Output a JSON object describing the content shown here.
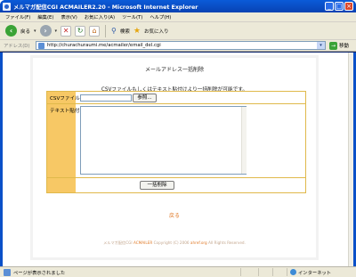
{
  "window": {
    "title": "メルマガ配信CGI ACMAILER2.20 - Microsoft Internet Explorer",
    "buttons": [
      "_",
      "□",
      "×"
    ]
  },
  "menubar": {
    "items": [
      "ファイル(F)",
      "編集(E)",
      "表示(V)",
      "お気に入り(A)",
      "ツール(T)",
      "ヘルプ(H)"
    ]
  },
  "toolbar": {
    "back_label": "戻る",
    "search_label": "検索",
    "favorites_label": "お気に入り"
  },
  "addressbar": {
    "label": "アドレス(D)",
    "url": "http://churachuraumi.me/acmailer/email_del.cgi",
    "go_label": "移動"
  },
  "page": {
    "heading": "メールアドレス一括削除",
    "note": "CSVファイルもしくはテキスト貼付けより一括削除が可能です。",
    "form": {
      "csv_label": "CSVファイル",
      "browse_label": "参照...",
      "text_label": "テキスト貼付",
      "textarea_value": "",
      "submit_label": "一括削除"
    },
    "back_link": "戻る",
    "footer": {
      "prefix": "メルマガ配信CGI ",
      "brand": "ACMAILER",
      "suffix": " Copyright (C) 2006 ",
      "owner": "ahref.org",
      "rights": " All Rights Reserved."
    }
  },
  "statusbar": {
    "text": "ページが表示されました",
    "zone": "インターネット"
  }
}
